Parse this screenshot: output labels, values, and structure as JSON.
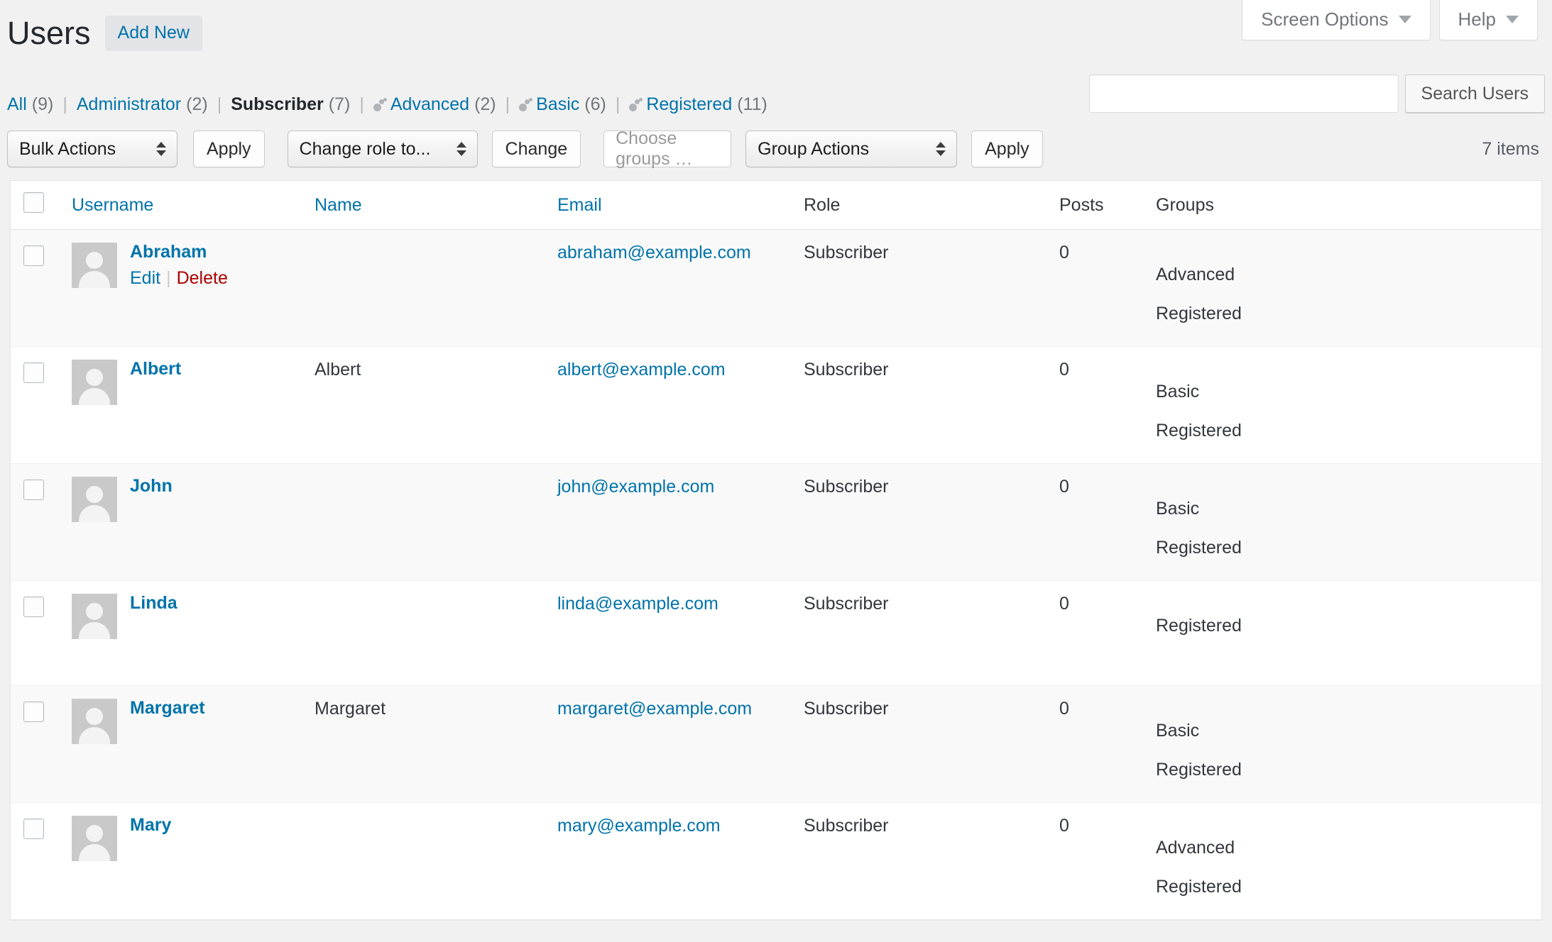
{
  "meta": {
    "screen_options_label": "Screen Options",
    "help_label": "Help"
  },
  "header": {
    "title": "Users",
    "add_new_label": "Add New"
  },
  "filters": [
    {
      "label": "All",
      "count": "(9)",
      "current": false,
      "has_group_icon": false
    },
    {
      "label": "Administrator",
      "count": "(2)",
      "current": false,
      "has_group_icon": false
    },
    {
      "label": "Subscriber",
      "count": "(7)",
      "current": true,
      "has_group_icon": false
    },
    {
      "label": "Advanced",
      "count": "(2)",
      "current": false,
      "has_group_icon": true
    },
    {
      "label": "Basic",
      "count": "(6)",
      "current": false,
      "has_group_icon": true
    },
    {
      "label": "Registered",
      "count": "(11)",
      "current": false,
      "has_group_icon": true
    }
  ],
  "search": {
    "value": "",
    "placeholder": "",
    "submit_label": "Search Users"
  },
  "tablenav": {
    "bulk_actions_label": "Bulk Actions",
    "apply_label": "Apply",
    "change_role_label": "Change role to...",
    "change_label": "Change",
    "choose_groups_placeholder": "Choose groups …",
    "group_actions_label": "Group Actions",
    "group_apply_label": "Apply",
    "displaying_num": "7 items"
  },
  "table": {
    "columns": [
      {
        "key": "cb",
        "label": "",
        "sortable": false
      },
      {
        "key": "user",
        "label": "Username",
        "sortable": true
      },
      {
        "key": "name",
        "label": "Name",
        "sortable": true
      },
      {
        "key": "email",
        "label": "Email",
        "sortable": true
      },
      {
        "key": "role",
        "label": "Role",
        "sortable": false
      },
      {
        "key": "posts",
        "label": "Posts",
        "sortable": false
      },
      {
        "key": "groups",
        "label": "Groups",
        "sortable": false
      }
    ],
    "row_actions": {
      "edit_label": "Edit",
      "delete_label": "Delete"
    },
    "rows": [
      {
        "username": "Abraham",
        "name": "",
        "email": "abraham@example.com",
        "role": "Subscriber",
        "posts": "0",
        "groups": [
          "Advanced",
          "Registered"
        ],
        "show_actions": true
      },
      {
        "username": "Albert",
        "name": "Albert",
        "email": "albert@example.com",
        "role": "Subscriber",
        "posts": "0",
        "groups": [
          "Basic",
          "Registered"
        ],
        "show_actions": false
      },
      {
        "username": "John",
        "name": "",
        "email": "john@example.com",
        "role": "Subscriber",
        "posts": "0",
        "groups": [
          "Basic",
          "Registered"
        ],
        "show_actions": false
      },
      {
        "username": "Linda",
        "name": "",
        "email": "linda@example.com",
        "role": "Subscriber",
        "posts": "0",
        "groups": [
          "Registered"
        ],
        "show_actions": false
      },
      {
        "username": "Margaret",
        "name": "Margaret",
        "email": "margaret@example.com",
        "role": "Subscriber",
        "posts": "0",
        "groups": [
          "Basic",
          "Registered"
        ],
        "show_actions": false
      },
      {
        "username": "Mary",
        "name": "",
        "email": "mary@example.com",
        "role": "Subscriber",
        "posts": "0",
        "groups": [
          "Advanced",
          "Registered"
        ],
        "show_actions": false
      }
    ]
  },
  "colors": {
    "link": "#0073aa",
    "delete": "#a00",
    "page_bg": "#f1f1f1",
    "row_alt_bg": "#f9f9f9",
    "text": "#32373c"
  }
}
